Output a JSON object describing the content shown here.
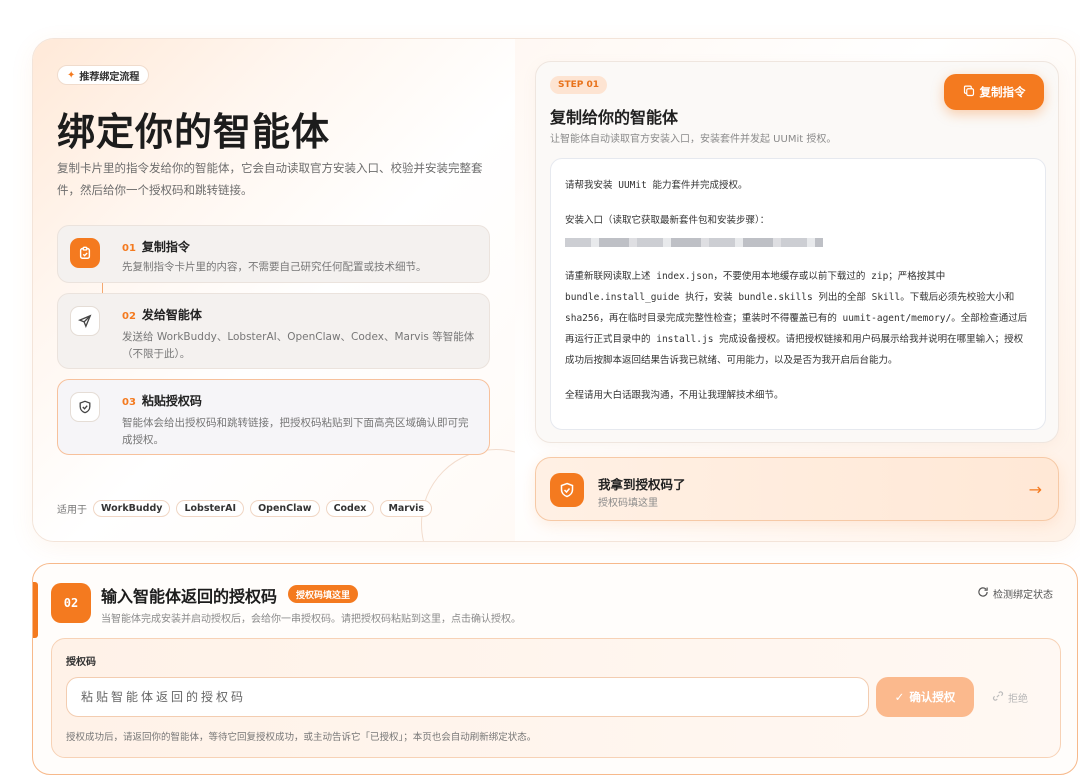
{
  "colors": {
    "accent": "#f47a1f",
    "accent_soft": "#fbb98d"
  },
  "hero": {
    "tag": "推荐绑定流程",
    "title": "绑定你的智能体",
    "description": "复制卡片里的指令发给你的智能体，它会自动读取官方安装入口、校验并安装完整套件，然后给你一个授权码和跳转链接。"
  },
  "steps": [
    {
      "num": "01",
      "title": "复制指令",
      "desc": "先复制指令卡片里的内容，不需要自己研究任何配置或技术细节。",
      "icon": "clipboard-icon"
    },
    {
      "num": "02",
      "title": "发给智能体",
      "desc": "发送给 WorkBuddy、LobsterAI、OpenClaw、Codex、Marvis 等智能体（不限于此）。",
      "icon": "send-icon"
    },
    {
      "num": "03",
      "title": "粘贴授权码",
      "desc": "智能体会给出授权码和跳转链接，把授权码粘贴到下面高亮区域确认即可完成授权。",
      "icon": "shield-icon"
    }
  ],
  "compat": {
    "label": "适用于",
    "agents": [
      "WorkBuddy",
      "LobsterAI",
      "OpenClaw",
      "Codex",
      "Marvis"
    ]
  },
  "step_card": {
    "badge": "STEP 01",
    "title": "复制给你的智能体",
    "subtitle": "让智能体自动读取官方安装入口，安装套件并发起 UUMit 授权。",
    "copy_label": "复制指令",
    "lines": {
      "l1": "请帮我安装 UUMit 能力套件并完成授权。",
      "l2": "安装入口（读取它获取最新套件包和安装步骤）：",
      "p1": "请重新联网读取上述 index.json，不要使用本地缓存或以前下载过的 zip；严格按其中 bundle.install_guide 执行，安装 bundle.skills 列出的全部 Skill。下载后必须先校验大小和 sha256，再在临时目录完成完整性检查；重装时不得覆盖已有的 uumit-agent/memory/。全部检查通过后再运行正式目录中的 install.js 完成设备授权。请把授权链接和用户码展示给我并说明在哪里输入；授权成功后按脚本返回结果告诉我已就绪、可用能力，以及是否为我开启后台能力。",
      "p2": "全程请用大白话跟我沟通，不用让我理解技术细节。"
    }
  },
  "got_code": {
    "title": "我拿到授权码了",
    "subtitle": "授权码填这里"
  },
  "auth": {
    "step_num": "02",
    "title": "输入智能体返回的授权码",
    "tag": "授权码填这里",
    "subtitle": "当智能体完成安装并启动授权后，会给你一串授权码。请把授权码粘贴到这里，点击确认授权。",
    "detect_label": "检测绑定状态",
    "field_label": "授权码",
    "placeholder": "粘贴智能体返回的授权码",
    "confirm_label": "确认授权",
    "reject_label": "拒绝",
    "hint": "授权成功后，请返回你的智能体，等待它回复授权成功，或主动告诉它「已授权」；本页也会自动刷新绑定状态。"
  }
}
